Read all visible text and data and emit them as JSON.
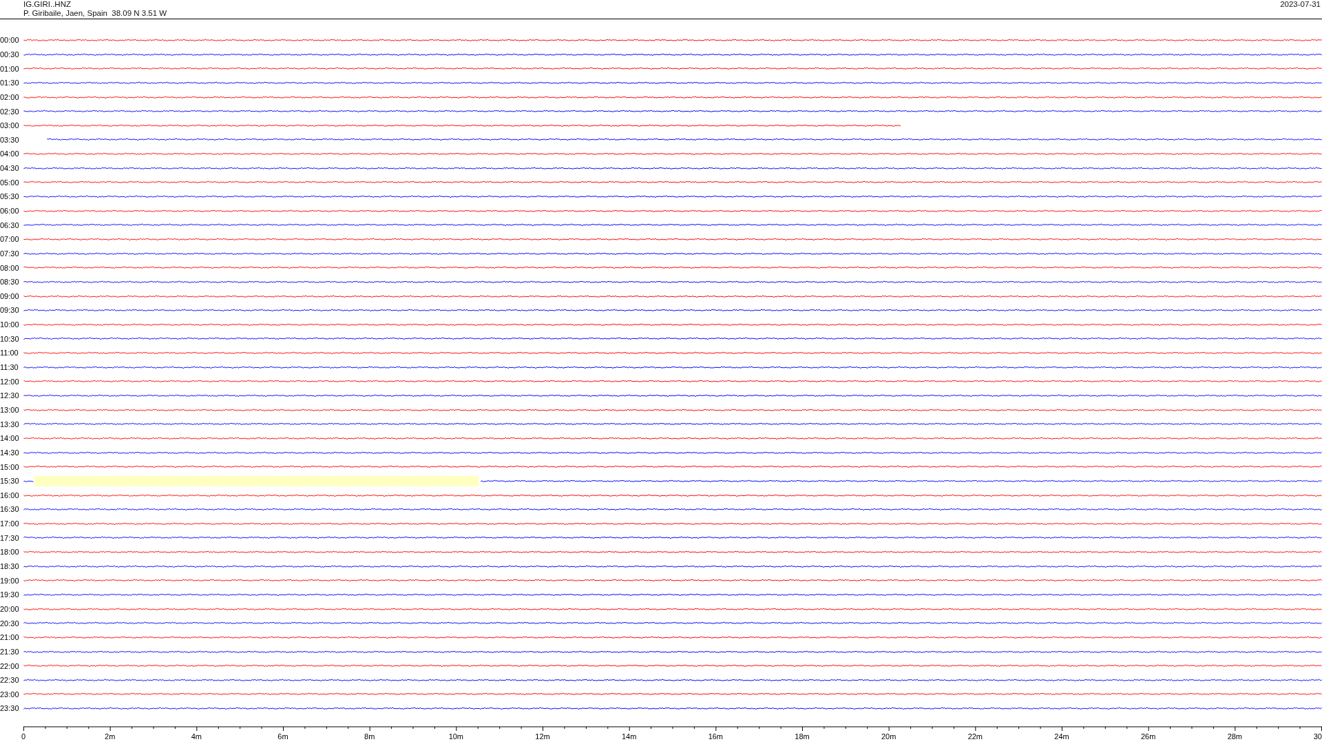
{
  "header": {
    "station": "IG.GIRI..HNZ",
    "location": "P. Giribaile, Jaen, Spain  38.09 N 3.51 W",
    "date": "2023-07-31"
  },
  "traces": [
    {
      "label": "00:00",
      "color": "#ff0000",
      "kind": "full"
    },
    {
      "label": "00:30",
      "color": "#0000ff",
      "kind": "full"
    },
    {
      "label": "01:00",
      "color": "#ff0000",
      "kind": "full"
    },
    {
      "label": "01:30",
      "color": "#0000ff",
      "kind": "full"
    },
    {
      "label": "02:00",
      "color": "#ff0000",
      "kind": "full"
    },
    {
      "label": "02:30",
      "color": "#0000ff",
      "kind": "full"
    },
    {
      "label": "03:00",
      "color": "#ff0000",
      "kind": "ends-early"
    },
    {
      "label": "03:30",
      "color": "#0000ff",
      "kind": "starts-late"
    },
    {
      "label": "04:00",
      "color": "#ff0000",
      "kind": "full"
    },
    {
      "label": "04:30",
      "color": "#0000ff",
      "kind": "full"
    },
    {
      "label": "05:00",
      "color": "#ff0000",
      "kind": "full"
    },
    {
      "label": "05:30",
      "color": "#0000ff",
      "kind": "full"
    },
    {
      "label": "06:00",
      "color": "#ff0000",
      "kind": "full"
    },
    {
      "label": "06:30",
      "color": "#0000ff",
      "kind": "full"
    },
    {
      "label": "07:00",
      "color": "#ff0000",
      "kind": "full"
    },
    {
      "label": "07:30",
      "color": "#0000ff",
      "kind": "full"
    },
    {
      "label": "08:00",
      "color": "#ff0000",
      "kind": "full"
    },
    {
      "label": "08:30",
      "color": "#0000ff",
      "kind": "full"
    },
    {
      "label": "09:00",
      "color": "#ff0000",
      "kind": "full"
    },
    {
      "label": "09:30",
      "color": "#0000ff",
      "kind": "full"
    },
    {
      "label": "10:00",
      "color": "#ff0000",
      "kind": "full"
    },
    {
      "label": "10:30",
      "color": "#0000ff",
      "kind": "full"
    },
    {
      "label": "11:00",
      "color": "#ff0000",
      "kind": "full"
    },
    {
      "label": "11:30",
      "color": "#0000ff",
      "kind": "full"
    },
    {
      "label": "12:00",
      "color": "#ff0000",
      "kind": "full"
    },
    {
      "label": "12:30",
      "color": "#0000ff",
      "kind": "full"
    },
    {
      "label": "13:00",
      "color": "#ff0000",
      "kind": "full"
    },
    {
      "label": "13:30",
      "color": "#0000ff",
      "kind": "full"
    },
    {
      "label": "14:00",
      "color": "#ff0000",
      "kind": "full"
    },
    {
      "label": "14:30",
      "color": "#0000ff",
      "kind": "full"
    },
    {
      "label": "15:00",
      "color": "#ff0000",
      "kind": "full"
    },
    {
      "label": "15:30",
      "color": "#0000ff",
      "kind": "gap"
    },
    {
      "label": "16:00",
      "color": "#ff0000",
      "kind": "full"
    },
    {
      "label": "16:30",
      "color": "#0000ff",
      "kind": "full"
    },
    {
      "label": "17:00",
      "color": "#ff0000",
      "kind": "full"
    },
    {
      "label": "17:30",
      "color": "#0000ff",
      "kind": "full"
    },
    {
      "label": "18:00",
      "color": "#ff0000",
      "kind": "full"
    },
    {
      "label": "18:30",
      "color": "#0000ff",
      "kind": "full"
    },
    {
      "label": "19:00",
      "color": "#ff0000",
      "kind": "full"
    },
    {
      "label": "19:30",
      "color": "#0000ff",
      "kind": "full"
    },
    {
      "label": "20:00",
      "color": "#ff0000",
      "kind": "full"
    },
    {
      "label": "20:30",
      "color": "#0000ff",
      "kind": "full"
    },
    {
      "label": "21:00",
      "color": "#ff0000",
      "kind": "full"
    },
    {
      "label": "21:30",
      "color": "#0000ff",
      "kind": "full"
    },
    {
      "label": "22:00",
      "color": "#ff0000",
      "kind": "full"
    },
    {
      "label": "22:30",
      "color": "#0000ff",
      "kind": "full"
    },
    {
      "label": "23:00",
      "color": "#ff0000",
      "kind": "full"
    },
    {
      "label": "23:30",
      "color": "#0000ff",
      "kind": "full"
    }
  ],
  "x_axis": {
    "labels": [
      "0",
      "2m",
      "4m",
      "6m",
      "8m",
      "10m",
      "12m",
      "14m",
      "16m",
      "18m",
      "20m",
      "22m",
      "24m",
      "26m",
      "28m",
      "30"
    ]
  }
}
